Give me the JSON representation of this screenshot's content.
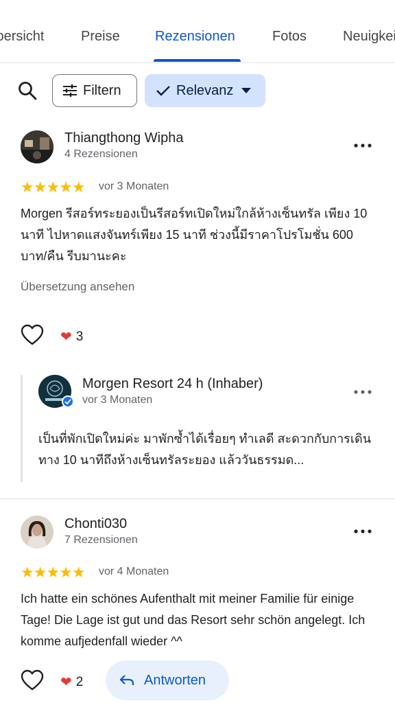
{
  "tabs": [
    {
      "label": "Übersicht"
    },
    {
      "label": "Preise"
    },
    {
      "label": "Rezensionen"
    },
    {
      "label": "Fotos"
    },
    {
      "label": "Neuigkeiten"
    }
  ],
  "toolbar": {
    "filter_label": "Filtern",
    "sort_label": "Relevanz"
  },
  "reviews": [
    {
      "name": "Thiangthong Wipha",
      "meta": "4 Rezensionen",
      "stars": "★★★★★",
      "date": "vor 3 Monaten",
      "text": "Morgen รีสอร์ทระยองเป็นรีสอร์ทเปิดใหม่ใกล้ห้างเซ็นทรัล เพียง 10 นาที ไปหาดแสงจันทร์เพียง 15 นาที ช่วงนี้มีราคาโปรโมชั่น 600 บาท/คืน รีบมานะคะ",
      "translate": "Übersetzung ansehen",
      "reaction_count": "3",
      "owner_reply": {
        "name": "Morgen Resort 24 h (Inhaber)",
        "date": "vor 3 Monaten",
        "text": "เป็นที่พักเปิดใหม่ค่ะ มาพักซ้ำได้เรื่อยๆ ทำเลดี สะดวกกับการเดินทาง 10 นาทีถึงห้างเซ็นทรัลระยอง แล้ววันธรรมด..."
      }
    },
    {
      "name": "Chonti030",
      "meta": "7 Rezensionen",
      "stars": "★★★★★",
      "date": "vor 4 Monaten",
      "text": "Ich hatte ein schönes Aufenthalt mit meiner Familie für einige Tage! Die Lage ist gut und das Resort sehr schön angelegt. Ich komme aufjedenfall wieder ^^",
      "reaction_count": "2",
      "reply_label": "Antworten"
    }
  ],
  "colors": {
    "accent": "#0b57d0",
    "star": "#fbbc04",
    "chip_selected_bg": "#d3e3fd"
  }
}
